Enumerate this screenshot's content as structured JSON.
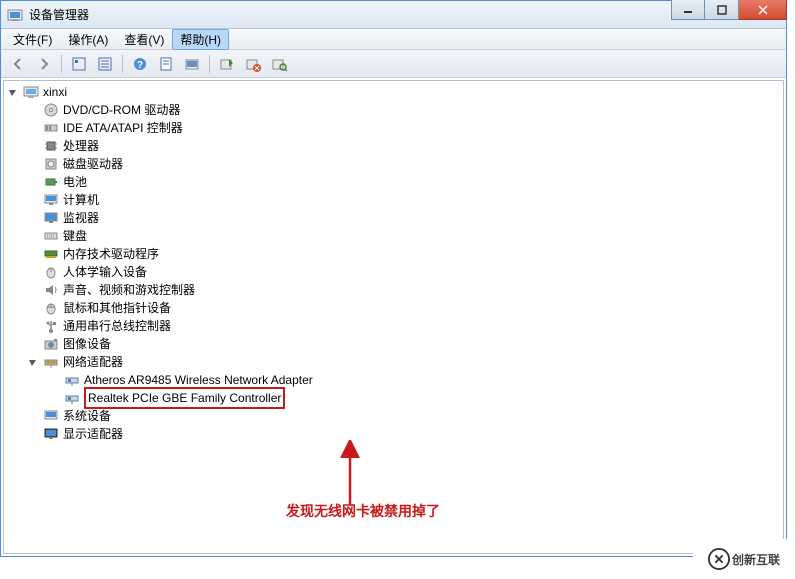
{
  "window": {
    "title": "设备管理器"
  },
  "menubar": {
    "items": [
      "文件(F)",
      "操作(A)",
      "查看(V)",
      "帮助(H)"
    ],
    "highlighted_index": 3
  },
  "toolbar": {
    "icons": [
      "nav-back-icon",
      "nav-fwd-icon",
      "show-hidden-icon",
      "details-icon",
      "help-icon",
      "properties-icon",
      "refresh-icon",
      "add-hw-icon",
      "uninstall-icon",
      "scan-icon"
    ]
  },
  "tree": {
    "root": {
      "label": "xinxi",
      "expanded": true
    },
    "categories": [
      {
        "label": "DVD/CD-ROM 驱动器",
        "icon": "dvd-icon"
      },
      {
        "label": "IDE ATA/ATAPI 控制器",
        "icon": "ide-icon"
      },
      {
        "label": "处理器",
        "icon": "cpu-icon"
      },
      {
        "label": "磁盘驱动器",
        "icon": "disk-icon"
      },
      {
        "label": "电池",
        "icon": "battery-icon"
      },
      {
        "label": "计算机",
        "icon": "computer-icon"
      },
      {
        "label": "监视器",
        "icon": "monitor-icon"
      },
      {
        "label": "键盘",
        "icon": "keyboard-icon"
      },
      {
        "label": "内存技术驱动程序",
        "icon": "memory-icon"
      },
      {
        "label": "人体学输入设备",
        "icon": "hid-icon"
      },
      {
        "label": "声音、视频和游戏控制器",
        "icon": "sound-icon"
      },
      {
        "label": "鼠标和其他指针设备",
        "icon": "mouse-icon"
      },
      {
        "label": "通用串行总线控制器",
        "icon": "usb-icon"
      },
      {
        "label": "图像设备",
        "icon": "imaging-icon"
      },
      {
        "label": "网络适配器",
        "icon": "network-icon",
        "expanded": true,
        "children": [
          {
            "label": "Atheros AR9485 Wireless Network Adapter",
            "icon": "nic-icon"
          },
          {
            "label": "Realtek PCIe GBE Family Controller",
            "icon": "nic-icon",
            "selected": true
          }
        ]
      },
      {
        "label": "系统设备",
        "icon": "system-icon"
      },
      {
        "label": "显示适配器",
        "icon": "display-icon"
      }
    ]
  },
  "annotation": {
    "text": "发现无线网卡被禁用掉了"
  },
  "watermark": {
    "text": "创新互联"
  }
}
